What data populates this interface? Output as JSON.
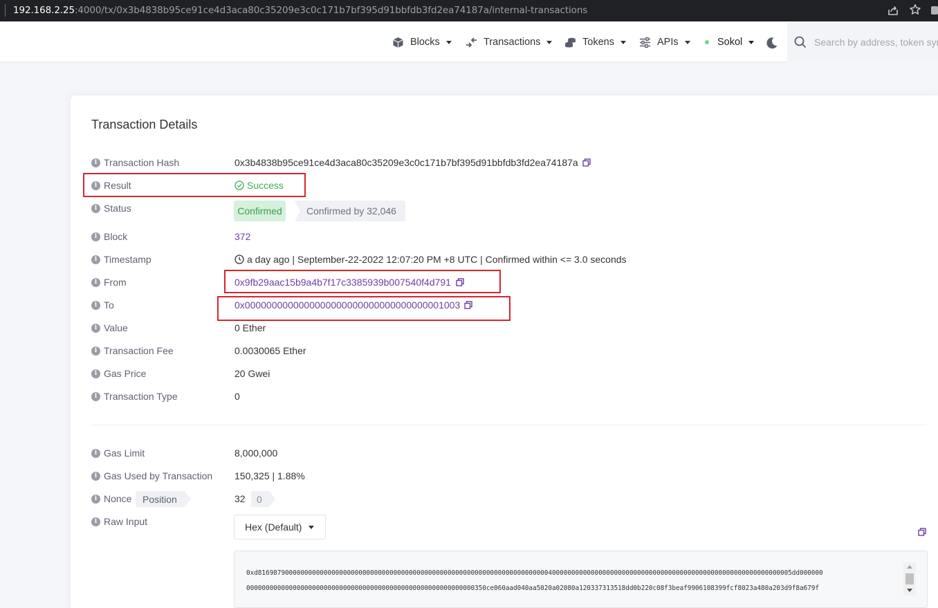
{
  "browser": {
    "url_host": "192.168.2.25",
    "url_path": ":4000/tx/0x3b4838b95ce91ce4d3aca80c35209e3c0c171b7bf395d91bbfdb3fd2ea74187a/internal-transactions"
  },
  "nav": {
    "blocks": "Blocks",
    "transactions": "Transactions",
    "tokens": "Tokens",
    "apis": "APIs",
    "network": "Sokol",
    "search_placeholder": "Search by address, token symbol, name, transaction hash, or block number"
  },
  "title": "Transaction Details",
  "fields": {
    "hash_label": "Transaction Hash",
    "hash_value": "0x3b4838b95ce91ce4d3aca80c35209e3c0c171b7bf395d91bbfdb3fd2ea74187a",
    "result_label": "Result",
    "result_value": "Success",
    "status_label": "Status",
    "status_badge": "Confirmed",
    "status_confirmations": "Confirmed by 32,046",
    "block_label": "Block",
    "block_value": "372",
    "timestamp_label": "Timestamp",
    "timestamp_value": "a day ago | September-22-2022 12:07:20 PM +8 UTC | Confirmed within <= 3.0 seconds",
    "from_label": "From",
    "from_value": "0x9fb29aac15b9a4b7f17c3385939b007540f4d791",
    "to_label": "To",
    "to_value": "0x0000000000000000000000000000000000001003",
    "value_label": "Value",
    "value_value": "0 Ether",
    "fee_label": "Transaction Fee",
    "fee_value": "0.0030065 Ether",
    "gas_price_label": "Gas Price",
    "gas_price_value": "20 Gwei",
    "type_label": "Transaction Type",
    "type_value": "0",
    "gas_limit_label": "Gas Limit",
    "gas_limit_value": "8,000,000",
    "gas_used_label": "Gas Used by Transaction",
    "gas_used_value": "150,325 | 1.88%",
    "nonce_label": "Nonce",
    "position_label": "Position",
    "nonce_value": "32",
    "position_value": "0",
    "raw_input_label": "Raw Input",
    "raw_format": "Hex (Default)",
    "raw_line1": "0xd816987900000000000000000000000000000000000000000000000000000000000000000000400000000000000000000000000000000000000000000000000000000000005dd000000",
    "raw_line2": "00000000000000000000000000000000000000000000000000000000000350ce060aad040aa5020a02080a120337313518dd0b220c08f3beaf9906108399fcf8023a480a203d9f8a679f"
  },
  "colors": {
    "link": "#6c3fa5",
    "success": "#3dad55",
    "confirmed_bg": "#d6f0db",
    "annotation": "#d9232d"
  }
}
